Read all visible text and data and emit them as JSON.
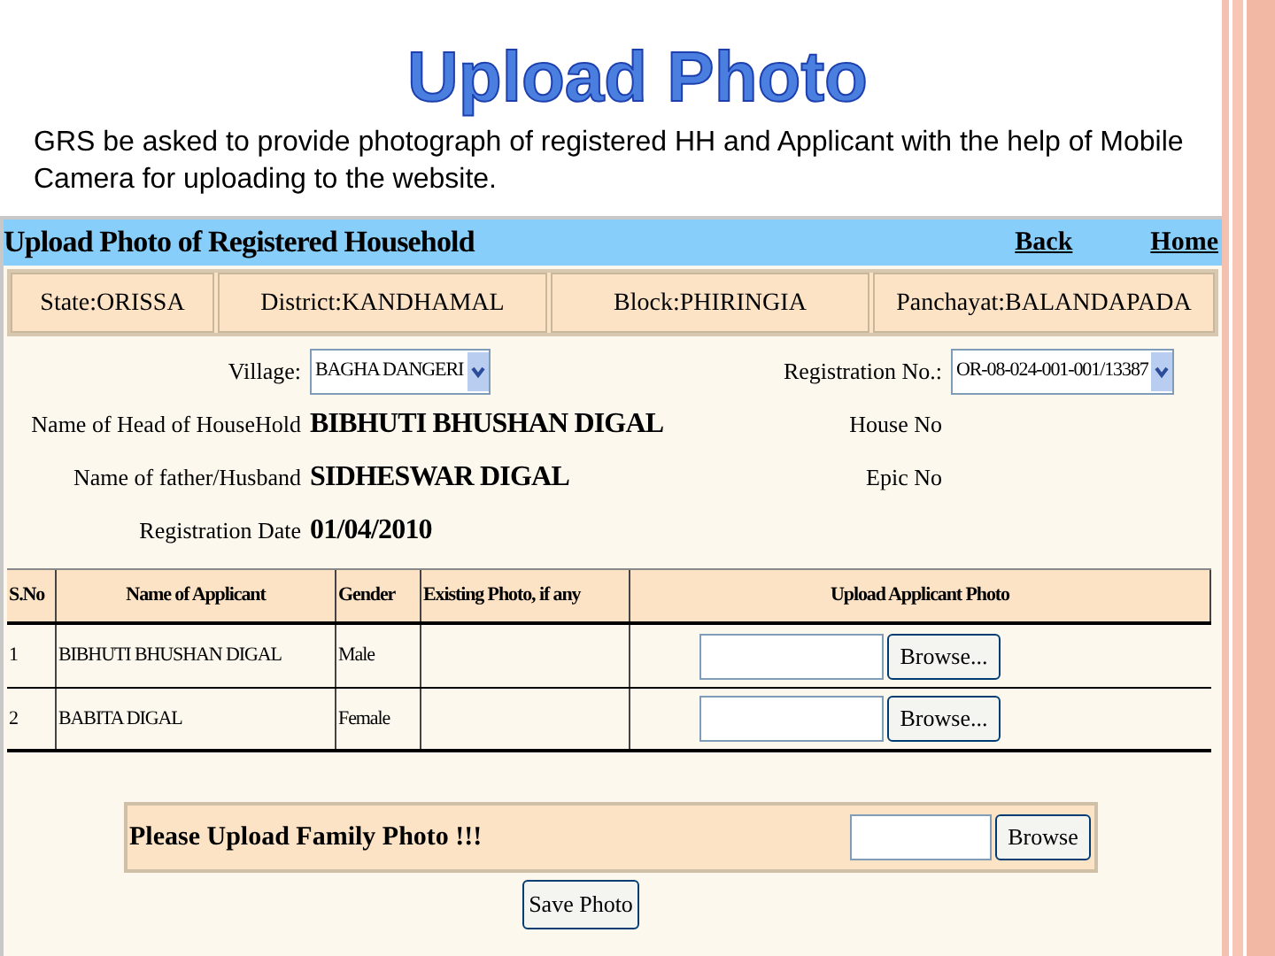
{
  "slide": {
    "title": "Upload Photo",
    "text": "GRS be asked to provide photograph of registered HH and Applicant with the help of Mobile Camera for uploading to the website."
  },
  "page": {
    "title": "Upload Photo of Registered Household",
    "links": [
      "Back",
      "Home"
    ],
    "location": [
      "State:ORISSA",
      "District:KANDHAMAL",
      "Block:PHIRINGIA",
      "Panchayat:BALANDAPADA"
    ],
    "village": {
      "label": "Village:",
      "value": "BAGHA DANGERI"
    },
    "registration": {
      "label": "Registration No.:",
      "value": "OR-08-024-001-001/13387"
    },
    "details": [
      {
        "label": "Name of Head of HouseHold",
        "value": "BIBHUTI BHUSHAN DIGAL",
        "side_label": "House No"
      },
      {
        "label": "Name of father/Husband",
        "value": "SIDHESWAR DIGAL",
        "side_label": "Epic No"
      },
      {
        "label": "Registration Date",
        "value": "01/04/2010"
      }
    ],
    "table": {
      "columns": [
        "S.No",
        "Name of Applicant",
        "Gender",
        "Existing Photo, if any",
        "Upload Applicant Photo"
      ],
      "rows": [
        {
          "s_no": "1",
          "name": "BIBHUTI BHUSHAN DIGAL",
          "gender": "Male",
          "button": "Browse..."
        },
        {
          "s_no": "2",
          "name": "BABITA DIGAL",
          "gender": "Female",
          "button": "Browse..."
        }
      ]
    },
    "family_photo": {
      "label": "Please Upload Family Photo !!!",
      "button": "Browse"
    },
    "save_button": "Save Photo"
  }
}
